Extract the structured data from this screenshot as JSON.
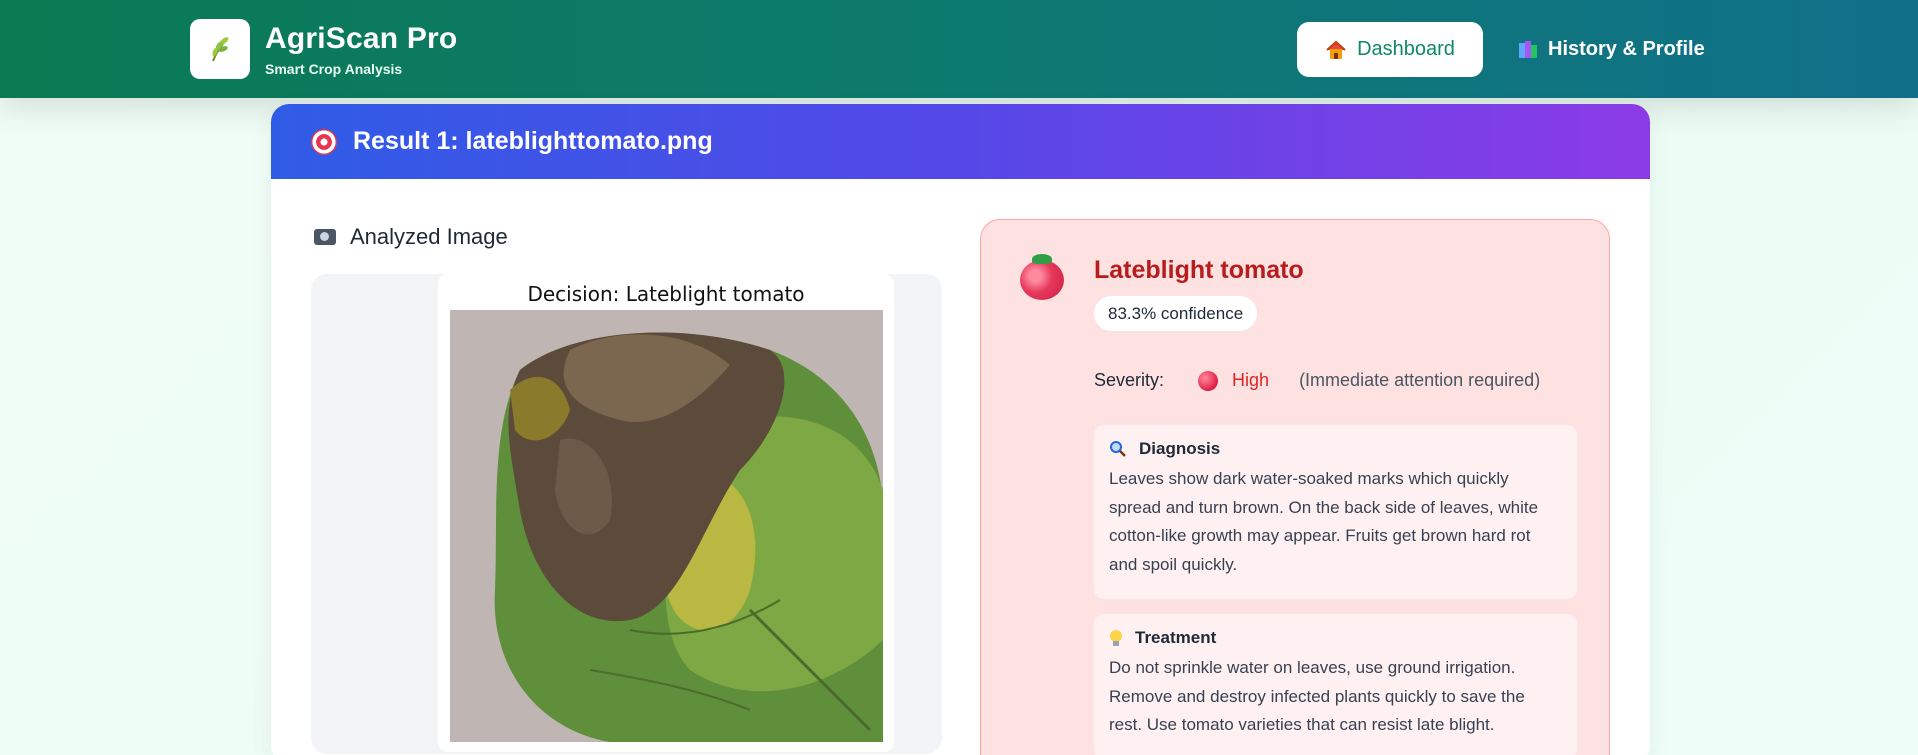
{
  "app": {
    "title": "AgriScan Pro",
    "subtitle": "Smart Crop Analysis",
    "logo_icon": "sprout-icon"
  },
  "nav": {
    "dashboard_label": "Dashboard",
    "dashboard_icon": "house-icon",
    "history_label": "History & Profile",
    "history_icon": "books-icon"
  },
  "result": {
    "title": "Result 1: lateblighttomato.png",
    "analyzed_label": "Analyzed Image",
    "decision_caption": "Decision: Lateblight tomato"
  },
  "diagnosis": {
    "disease": "Lateblight tomato",
    "confidence": "83.3% confidence",
    "severity_label": "Severity:",
    "severity_level": "High",
    "severity_note": "(Immediate attention required)",
    "diagnosis_title": "Diagnosis",
    "diagnosis_text": "Leaves show dark water-soaked marks which quickly spread and turn brown. On the back side of leaves, white cotton-like growth may appear. Fruits get brown hard rot and spoil quickly.",
    "treatment_title": "Treatment",
    "treatment_text": "Do not sprinkle water on leaves, use ground irrigation. Remove and destroy infected plants quickly to save the rest. Use tomato varieties that can resist late blight."
  },
  "colors": {
    "header_green": "#0a7a52",
    "accent_purple": "#8b3be6",
    "severity_red": "#dc2626",
    "panel_pink": "#fee2e2"
  }
}
